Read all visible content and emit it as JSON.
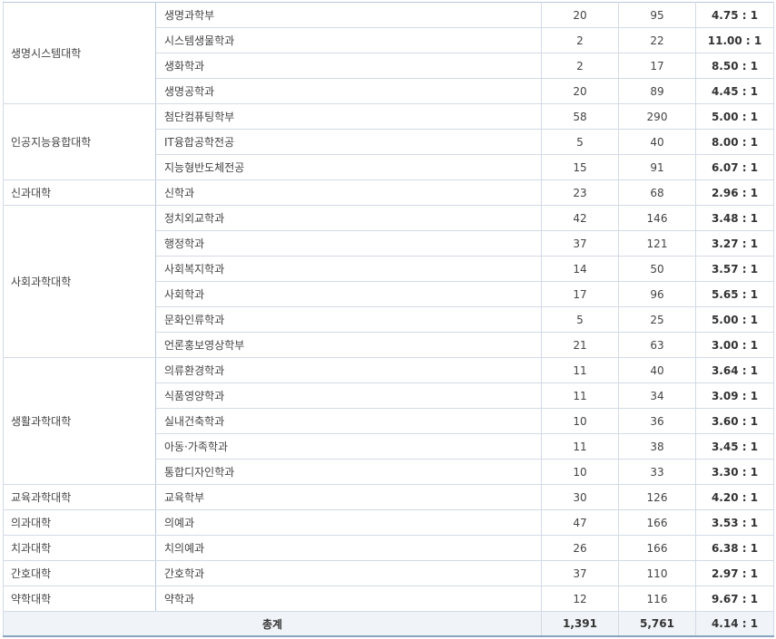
{
  "groups": [
    {
      "college": "생명시스템대학",
      "rows": [
        [
          "생명과학부",
          "20",
          "95",
          "4.75 : 1"
        ],
        [
          "시스템생물학과",
          "2",
          "22",
          "11.00 : 1"
        ],
        [
          "생화학과",
          "2",
          "17",
          "8.50 : 1"
        ],
        [
          "생명공학과",
          "20",
          "89",
          "4.45 : 1"
        ]
      ]
    },
    {
      "college": "인공지능융합대학",
      "rows": [
        [
          "첨단컴퓨팅학부",
          "58",
          "290",
          "5.00 : 1"
        ],
        [
          "IT융합공학전공",
          "5",
          "40",
          "8.00 : 1"
        ],
        [
          "지능형반도체전공",
          "15",
          "91",
          "6.07 : 1"
        ]
      ]
    },
    {
      "college": "신과대학",
      "rows": [
        [
          "신학과",
          "23",
          "68",
          "2.96 : 1"
        ]
      ]
    },
    {
      "college": "사회과학대학",
      "rows": [
        [
          "정치외교학과",
          "42",
          "146",
          "3.48 : 1"
        ],
        [
          "행정학과",
          "37",
          "121",
          "3.27 : 1"
        ],
        [
          "사회복지학과",
          "14",
          "50",
          "3.57 : 1"
        ],
        [
          "사회학과",
          "17",
          "96",
          "5.65 : 1"
        ],
        [
          "문화인류학과",
          "5",
          "25",
          "5.00 : 1"
        ],
        [
          "언론홍보영상학부",
          "21",
          "63",
          "3.00 : 1"
        ]
      ]
    },
    {
      "college": "생활과학대학",
      "rows": [
        [
          "의류환경학과",
          "11",
          "40",
          "3.64 : 1"
        ],
        [
          "식품영양학과",
          "11",
          "34",
          "3.09 : 1"
        ],
        [
          "실내건축학과",
          "10",
          "36",
          "3.60 : 1"
        ],
        [
          "아동·가족학과",
          "11",
          "38",
          "3.45 : 1"
        ],
        [
          "통합디자인학과",
          "10",
          "33",
          "3.30 : 1"
        ]
      ]
    },
    {
      "college": "교육과학대학",
      "rows": [
        [
          "교육학부",
          "30",
          "126",
          "4.20 : 1"
        ]
      ]
    },
    {
      "college": "의과대학",
      "rows": [
        [
          "의예과",
          "47",
          "166",
          "3.53 : 1"
        ]
      ]
    },
    {
      "college": "치과대학",
      "rows": [
        [
          "치의예과",
          "26",
          "166",
          "6.38 : 1"
        ]
      ]
    },
    {
      "college": "간호대학",
      "rows": [
        [
          "간호학과",
          "37",
          "110",
          "2.97 : 1"
        ]
      ]
    },
    {
      "college": "약학대학",
      "rows": [
        [
          "약학과",
          "12",
          "116",
          "9.67 : 1"
        ]
      ]
    }
  ],
  "total": {
    "label": "총계",
    "quota": "1,391",
    "applicants": "5,761",
    "ratio": "4.14 : 1"
  }
}
